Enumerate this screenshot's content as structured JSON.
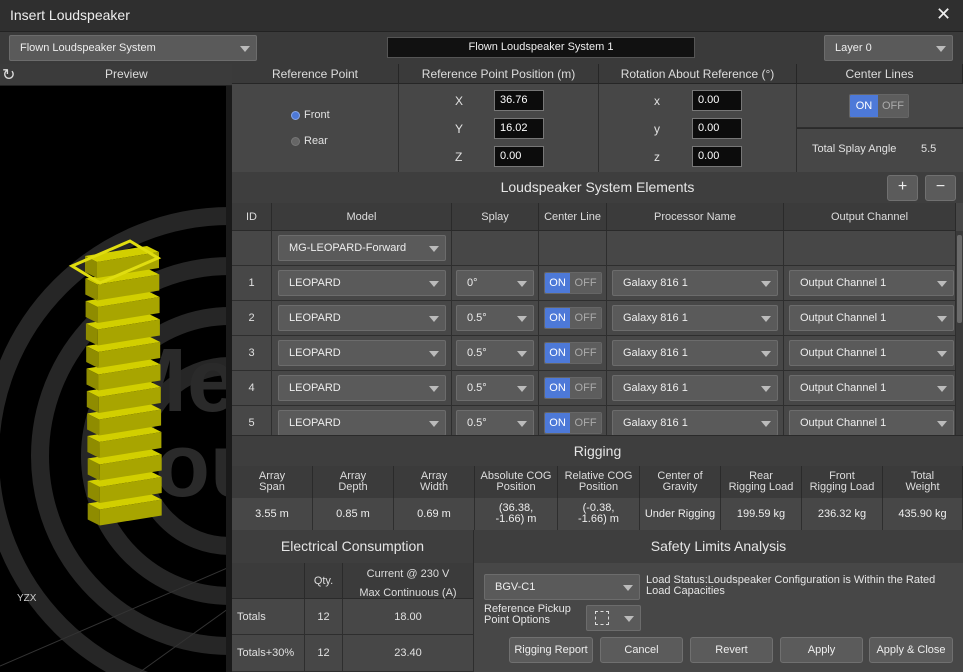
{
  "window": {
    "title": "Insert Loudspeaker",
    "close_icon": "close-icon"
  },
  "top_bar": {
    "system_type": "Flown Loudspeaker System",
    "system_name": "Flown Loudspeaker System 1",
    "layer": "Layer 0"
  },
  "preview": {
    "label": "Preview",
    "axis_label": "YZX",
    "watermark_1": "Me",
    "watermark_2": "Sou"
  },
  "reference_point": {
    "header": "Reference Point",
    "front_label": "Front",
    "rear_label": "Rear",
    "selected": "Front"
  },
  "position": {
    "header": "Reference Point Position (m)",
    "x_label": "X",
    "x": "36.76",
    "y_label": "Y",
    "y": "16.02",
    "z_label": "Z",
    "z": "0.00"
  },
  "rotation": {
    "header": "Rotation About Reference (°)",
    "x_label": "x",
    "x": "0.00",
    "y_label": "y",
    "y": "0.00",
    "z_label": "z",
    "z": "0.00"
  },
  "center_lines": {
    "header": "Center Lines",
    "on": "ON",
    "off": "OFF",
    "splay_label": "Total Splay Angle",
    "splay_value": "5.5"
  },
  "elements": {
    "title": "Loudspeaker System Elements",
    "add": "+",
    "remove": "−",
    "columns": [
      "ID",
      "Model",
      "Splay",
      "Center Line",
      "Processor Name",
      "Output Channel"
    ],
    "default_model": "MG-LEOPARD-Forward",
    "rows": [
      {
        "id": "1",
        "model": "LEOPARD",
        "splay": "0°",
        "on": "ON",
        "off": "OFF",
        "processor": "Galaxy 816 1",
        "output": "Output Channel 1"
      },
      {
        "id": "2",
        "model": "LEOPARD",
        "splay": "0.5°",
        "on": "ON",
        "off": "OFF",
        "processor": "Galaxy 816 1",
        "output": "Output Channel 1"
      },
      {
        "id": "3",
        "model": "LEOPARD",
        "splay": "0.5°",
        "on": "ON",
        "off": "OFF",
        "processor": "Galaxy 816 1",
        "output": "Output Channel 1"
      },
      {
        "id": "4",
        "model": "LEOPARD",
        "splay": "0.5°",
        "on": "ON",
        "off": "OFF",
        "processor": "Galaxy 816 1",
        "output": "Output Channel 1"
      },
      {
        "id": "5",
        "model": "LEOPARD",
        "splay": "0.5°",
        "on": "ON",
        "off": "OFF",
        "processor": "Galaxy 816 1",
        "output": "Output Channel 1"
      }
    ]
  },
  "rigging": {
    "title": "Rigging",
    "headers": [
      [
        "Array",
        "Span"
      ],
      [
        "Array",
        "Depth"
      ],
      [
        "Array",
        "Width"
      ],
      [
        "Absolute COG",
        "Position"
      ],
      [
        "Relative COG",
        "Position"
      ],
      [
        "Center of",
        "Gravity"
      ],
      [
        "Rear",
        "Rigging Load"
      ],
      [
        "Front",
        "Rigging Load"
      ],
      [
        "Total",
        "Weight"
      ]
    ],
    "values": [
      [
        "3.55 m"
      ],
      [
        "0.85 m"
      ],
      [
        "0.69 m"
      ],
      [
        "(36.38,",
        "-1.66) m"
      ],
      [
        "(-0.38,",
        "-1.66) m"
      ],
      [
        "Under Rigging"
      ],
      [
        "199.59 kg"
      ],
      [
        "236.32 kg"
      ],
      [
        "435.90 kg"
      ]
    ]
  },
  "electrical": {
    "title": "Electrical Consumption",
    "qty_header": "Qty.",
    "current_header_1": "Current @ 230 V",
    "current_header_2": "Max Continuous (A)",
    "rows": [
      {
        "label": "Totals",
        "qty": "12",
        "current": "18.00"
      },
      {
        "label": "Totals+30%",
        "qty": "12",
        "current": "23.40"
      }
    ]
  },
  "safety": {
    "title": "Safety Limits Analysis",
    "standard": "BGV-C1",
    "status_line_1": "Load Status:Loudspeaker Configuration is Within the Rated",
    "status_line_2": "Load Capacities",
    "pickup_label_1": "Reference Pickup",
    "pickup_label_2": "Point Options"
  },
  "buttons": {
    "rigging_report": "Rigging Report",
    "cancel": "Cancel",
    "revert": "Revert",
    "apply": "Apply",
    "apply_close": "Apply & Close"
  }
}
